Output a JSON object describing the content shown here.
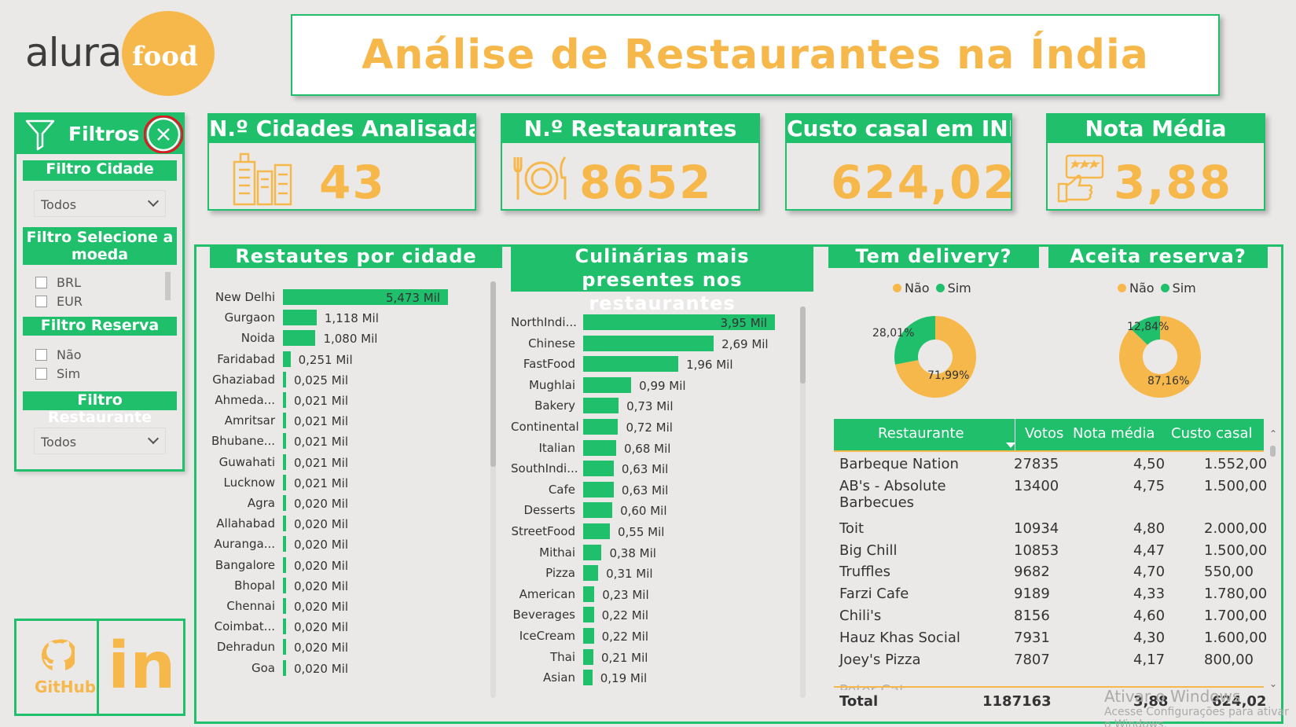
{
  "brand": {
    "logo_left": "alura",
    "logo_right": "food"
  },
  "title": "Análise de Restaurantes na Índia",
  "colors": {
    "accent": "#1fbf6b",
    "highlight": "#f7b84b",
    "background": "#ebe9e8"
  },
  "filters": {
    "header": "Filtros",
    "filter_icon": "funnel-icon",
    "close_icon": "close-circle-icon",
    "city": {
      "label": "Filtro Cidade",
      "selected": "Todos"
    },
    "currency": {
      "label": "Filtro Selecione a moeda",
      "options": [
        "BRL",
        "EUR"
      ]
    },
    "reservation": {
      "label": "Filtro Reserva",
      "options": [
        "Não",
        "Sim"
      ]
    },
    "restaurant": {
      "label": "Filtro Restaurante",
      "selected": "Todos"
    }
  },
  "kpis": [
    {
      "title": "N.º Cidades Analisadas",
      "value": "43",
      "icon": "buildings-icon"
    },
    {
      "title": "N.º Restaurantes",
      "value": "8652",
      "icon": "plate-cutlery-icon"
    },
    {
      "title": "Custo casal em INR",
      "value": "624,02"
    },
    {
      "title": "Nota Média",
      "value": "3,88",
      "icon": "rating-hand-icon"
    }
  ],
  "social": {
    "github_label": "GitHub",
    "linkedin_label": "in"
  },
  "chart_data": [
    {
      "type": "bar",
      "title": "Restautes por cidade",
      "categories": [
        "New Delhi",
        "Gurgaon",
        "Noida",
        "Faridabad",
        "Ghaziabad",
        "Ahmeda...",
        "Amritsar",
        "Bhubane...",
        "Guwahati",
        "Lucknow",
        "Agra",
        "Allahabad",
        "Auranga...",
        "Bangalore",
        "Bhopal",
        "Chennai",
        "Coimbat...",
        "Dehradun",
        "Goa"
      ],
      "values": [
        5.473,
        1.118,
        1.08,
        0.251,
        0.025,
        0.021,
        0.021,
        0.021,
        0.021,
        0.021,
        0.02,
        0.02,
        0.02,
        0.02,
        0.02,
        0.02,
        0.02,
        0.02,
        0.02
      ],
      "labels": [
        "5,473 Mil",
        "1,118 Mil",
        "1,080 Mil",
        "0,251 Mil",
        "0,025 Mil",
        "0,021 Mil",
        "0,021 Mil",
        "0,021 Mil",
        "0,021 Mil",
        "0,021 Mil",
        "0,020 Mil",
        "0,020 Mil",
        "0,020 Mil",
        "0,020 Mil",
        "0,020 Mil",
        "0,020 Mil",
        "0,020 Mil",
        "0,020 Mil",
        "0,020 Mil"
      ]
    },
    {
      "type": "bar",
      "title": "Culinárias mais presentes nos restaurantes",
      "categories": [
        "NorthIndi...",
        "Chinese",
        "FastFood",
        "Mughlai",
        "Bakery",
        "Continental",
        "Italian",
        "SouthIndi...",
        "Cafe",
        "Desserts",
        "StreetFood",
        "Mithai",
        "Pizza",
        "American",
        "Beverages",
        "IceCream",
        "Thai",
        "Asian"
      ],
      "values": [
        3.95,
        2.69,
        1.96,
        0.99,
        0.73,
        0.72,
        0.68,
        0.63,
        0.63,
        0.6,
        0.55,
        0.38,
        0.31,
        0.23,
        0.22,
        0.22,
        0.21,
        0.19
      ],
      "labels": [
        "3,95 Mil",
        "2,69 Mil",
        "1,96 Mil",
        "0,99 Mil",
        "0,73 Mil",
        "0,72 Mil",
        "0,68 Mil",
        "0,63 Mil",
        "0,63 Mil",
        "0,60 Mil",
        "0,55 Mil",
        "0,38 Mil",
        "0,31 Mil",
        "0,23 Mil",
        "0,22 Mil",
        "0,22 Mil",
        "0,21 Mil",
        "0,19 Mil"
      ]
    },
    {
      "type": "pie",
      "title": "Tem delivery?",
      "categories": [
        "Não",
        "Sim"
      ],
      "values": [
        71.99,
        28.01
      ],
      "labels": [
        "71,99%",
        "28,01%"
      ],
      "colors": [
        "#f7b84b",
        "#1fbf6b"
      ]
    },
    {
      "type": "pie",
      "title": "Aceita reserva?",
      "categories": [
        "Não",
        "Sim"
      ],
      "values": [
        87.16,
        12.84
      ],
      "labels": [
        "87,16%",
        "12,84%"
      ],
      "colors": [
        "#f7b84b",
        "#1fbf6b"
      ]
    },
    {
      "type": "table",
      "columns": [
        "Restaurante",
        "Votos",
        "Nota média",
        "Custo casal"
      ],
      "rows": [
        [
          "Barbeque Nation",
          "27835",
          "4,50",
          "1.552,00"
        ],
        [
          "AB's - Absolute Barbecues",
          "13400",
          "4,75",
          "1.500,00"
        ],
        [
          "Toit",
          "10934",
          "4,80",
          "2.000,00"
        ],
        [
          "Big Chill",
          "10853",
          "4,47",
          "1.500,00"
        ],
        [
          "Truffles",
          "9682",
          "4,70",
          "550,00"
        ],
        [
          "Farzi Cafe",
          "9189",
          "4,33",
          "1.780,00"
        ],
        [
          "Chili's",
          "8156",
          "4,60",
          "1.700,00"
        ],
        [
          "Hauz Khas Social",
          "7931",
          "4,30",
          "1.600,00"
        ],
        [
          "Joey's Pizza",
          "7807",
          "4,17",
          "800,00"
        ]
      ],
      "total": [
        "Total",
        "1187163",
        "3,88",
        "624,02"
      ]
    }
  ],
  "os_watermark": {
    "line1": "Ativar o Windows",
    "line2": "Acesse Configurações para ativar o Windows."
  }
}
